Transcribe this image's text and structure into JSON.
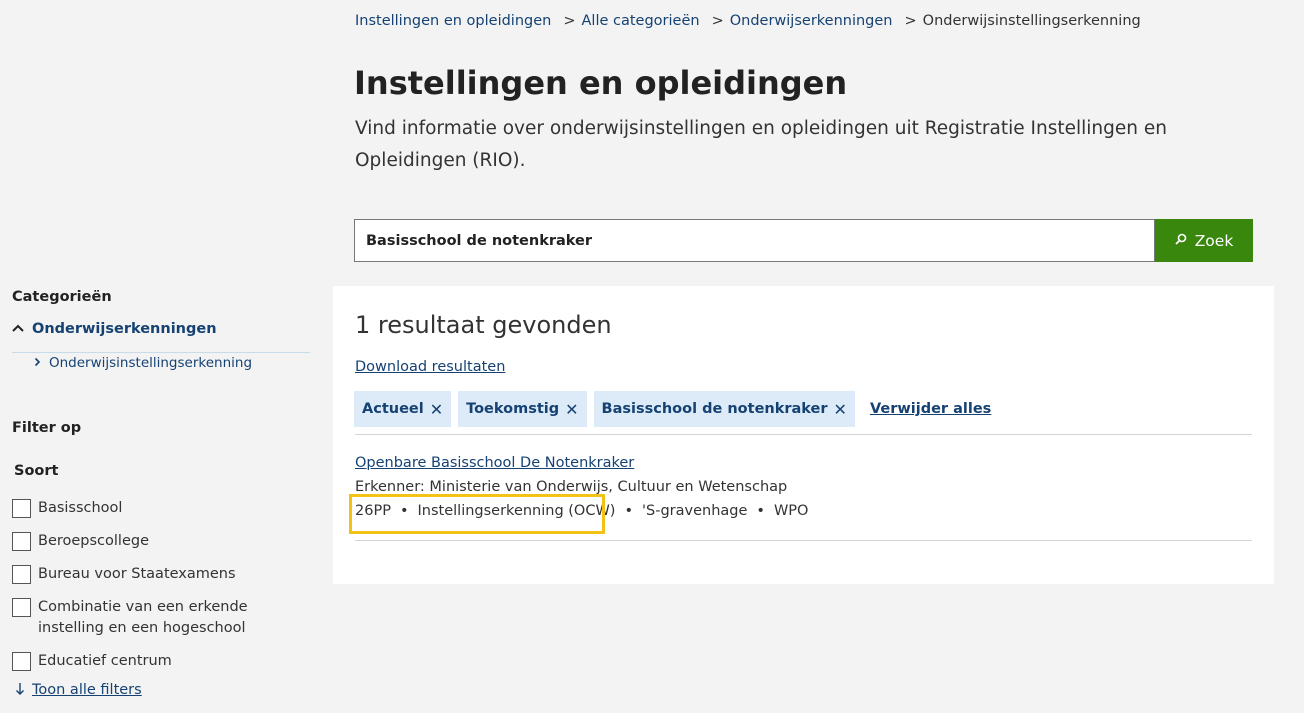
{
  "breadcrumb": {
    "items": [
      "Instellingen en opleidingen",
      "Alle categorieën",
      "Onderwijserkenningen"
    ],
    "separator": ">",
    "current": "Onderwijsinstellingserkenning"
  },
  "header": {
    "title": "Instellingen en opleidingen",
    "intro": "Vind informatie over onderwijsinstellingen en opleidingen uit Registratie Instellingen en Opleidingen (RIO)."
  },
  "search": {
    "value": "Basisschool de notenkraker",
    "button_label": "Zoek",
    "button_icon": "search-icon"
  },
  "sidebar": {
    "categories_title": "Categorieën",
    "category_main": "Onderwijserkenningen",
    "category_sub": "Onderwijsinstellingserkenning",
    "filter_title": "Filter op",
    "soort_title": "Soort",
    "filters": [
      "Basisschool",
      "Beroepscollege",
      "Bureau voor Staatexamens",
      "Combinatie van een erkende instelling en een hogeschool",
      "Educatief centrum"
    ],
    "show_all": "Toon alle filters"
  },
  "results": {
    "count_text": "1 resultaat gevonden",
    "download_label": "Download resultaten",
    "chips": [
      "Actueel",
      "Toekomstig",
      "Basisschool de notenkraker"
    ],
    "remove_all": "Verwijder alles",
    "items": [
      {
        "title": "Openbare Basisschool De Notenkraker",
        "erkenner": "Erkenner: Ministerie van Onderwijs, Cultuur en Wetenschap",
        "code": "26PP",
        "type": "Instellingserkenning (OCW)",
        "city": "'S-gravenhage",
        "law": "WPO"
      }
    ]
  },
  "colors": {
    "link": "#154273",
    "search_button": "#39870c",
    "chip_background": "#dcebf7",
    "highlight": "#f2c316"
  }
}
